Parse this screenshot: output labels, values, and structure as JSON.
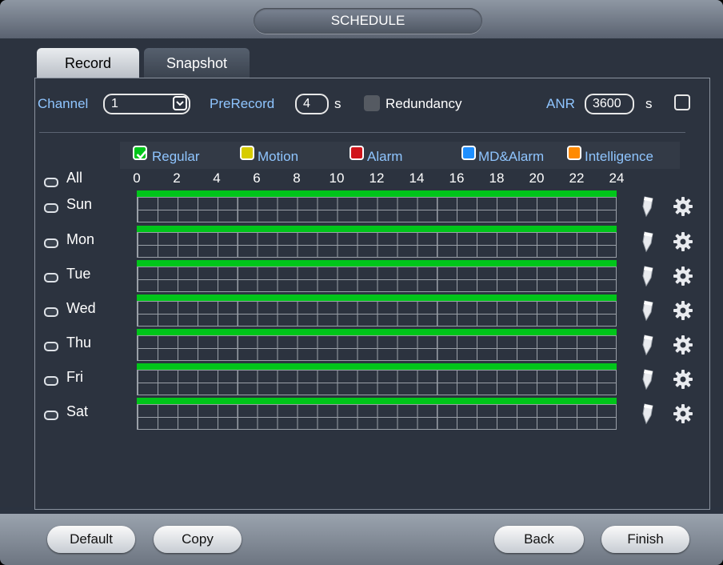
{
  "title": "SCHEDULE",
  "tabs": [
    {
      "label": "Record",
      "active": true
    },
    {
      "label": "Snapshot",
      "active": false
    }
  ],
  "channel": {
    "label": "Channel",
    "value": "1"
  },
  "prerecord": {
    "label": "PreRecord",
    "value": "4",
    "unit": "s"
  },
  "redundancy": {
    "label": "Redundancy",
    "checked": false
  },
  "anr": {
    "label": "ANR",
    "value": "3600",
    "unit": "s",
    "checked": false
  },
  "legend": [
    {
      "label": "Regular",
      "color": "#00c51a",
      "checked": true
    },
    {
      "label": "Motion",
      "color": "#d7cc00",
      "checked": false
    },
    {
      "label": "Alarm",
      "color": "#d0141a",
      "checked": false
    },
    {
      "label": "MD&Alarm",
      "color": "#1e8fff",
      "checked": false
    },
    {
      "label": "Intelligence",
      "color": "#ff8a00",
      "checked": false
    }
  ],
  "all_label": "All",
  "hour_ticks": [
    "0",
    "2",
    "4",
    "6",
    "8",
    "10",
    "12",
    "14",
    "16",
    "18",
    "20",
    "22",
    "24"
  ],
  "days": [
    {
      "label": "Sun",
      "regular_hours": [
        0,
        24
      ]
    },
    {
      "label": "Mon",
      "regular_hours": [
        0,
        24
      ]
    },
    {
      "label": "Tue",
      "regular_hours": [
        0,
        24
      ]
    },
    {
      "label": "Wed",
      "regular_hours": [
        0,
        24
      ]
    },
    {
      "label": "Thu",
      "regular_hours": [
        0,
        24
      ]
    },
    {
      "label": "Fri",
      "regular_hours": [
        0,
        24
      ]
    },
    {
      "label": "Sat",
      "regular_hours": [
        0,
        24
      ]
    }
  ],
  "buttons": {
    "default": "Default",
    "copy": "Copy",
    "back": "Back",
    "finish": "Finish"
  }
}
